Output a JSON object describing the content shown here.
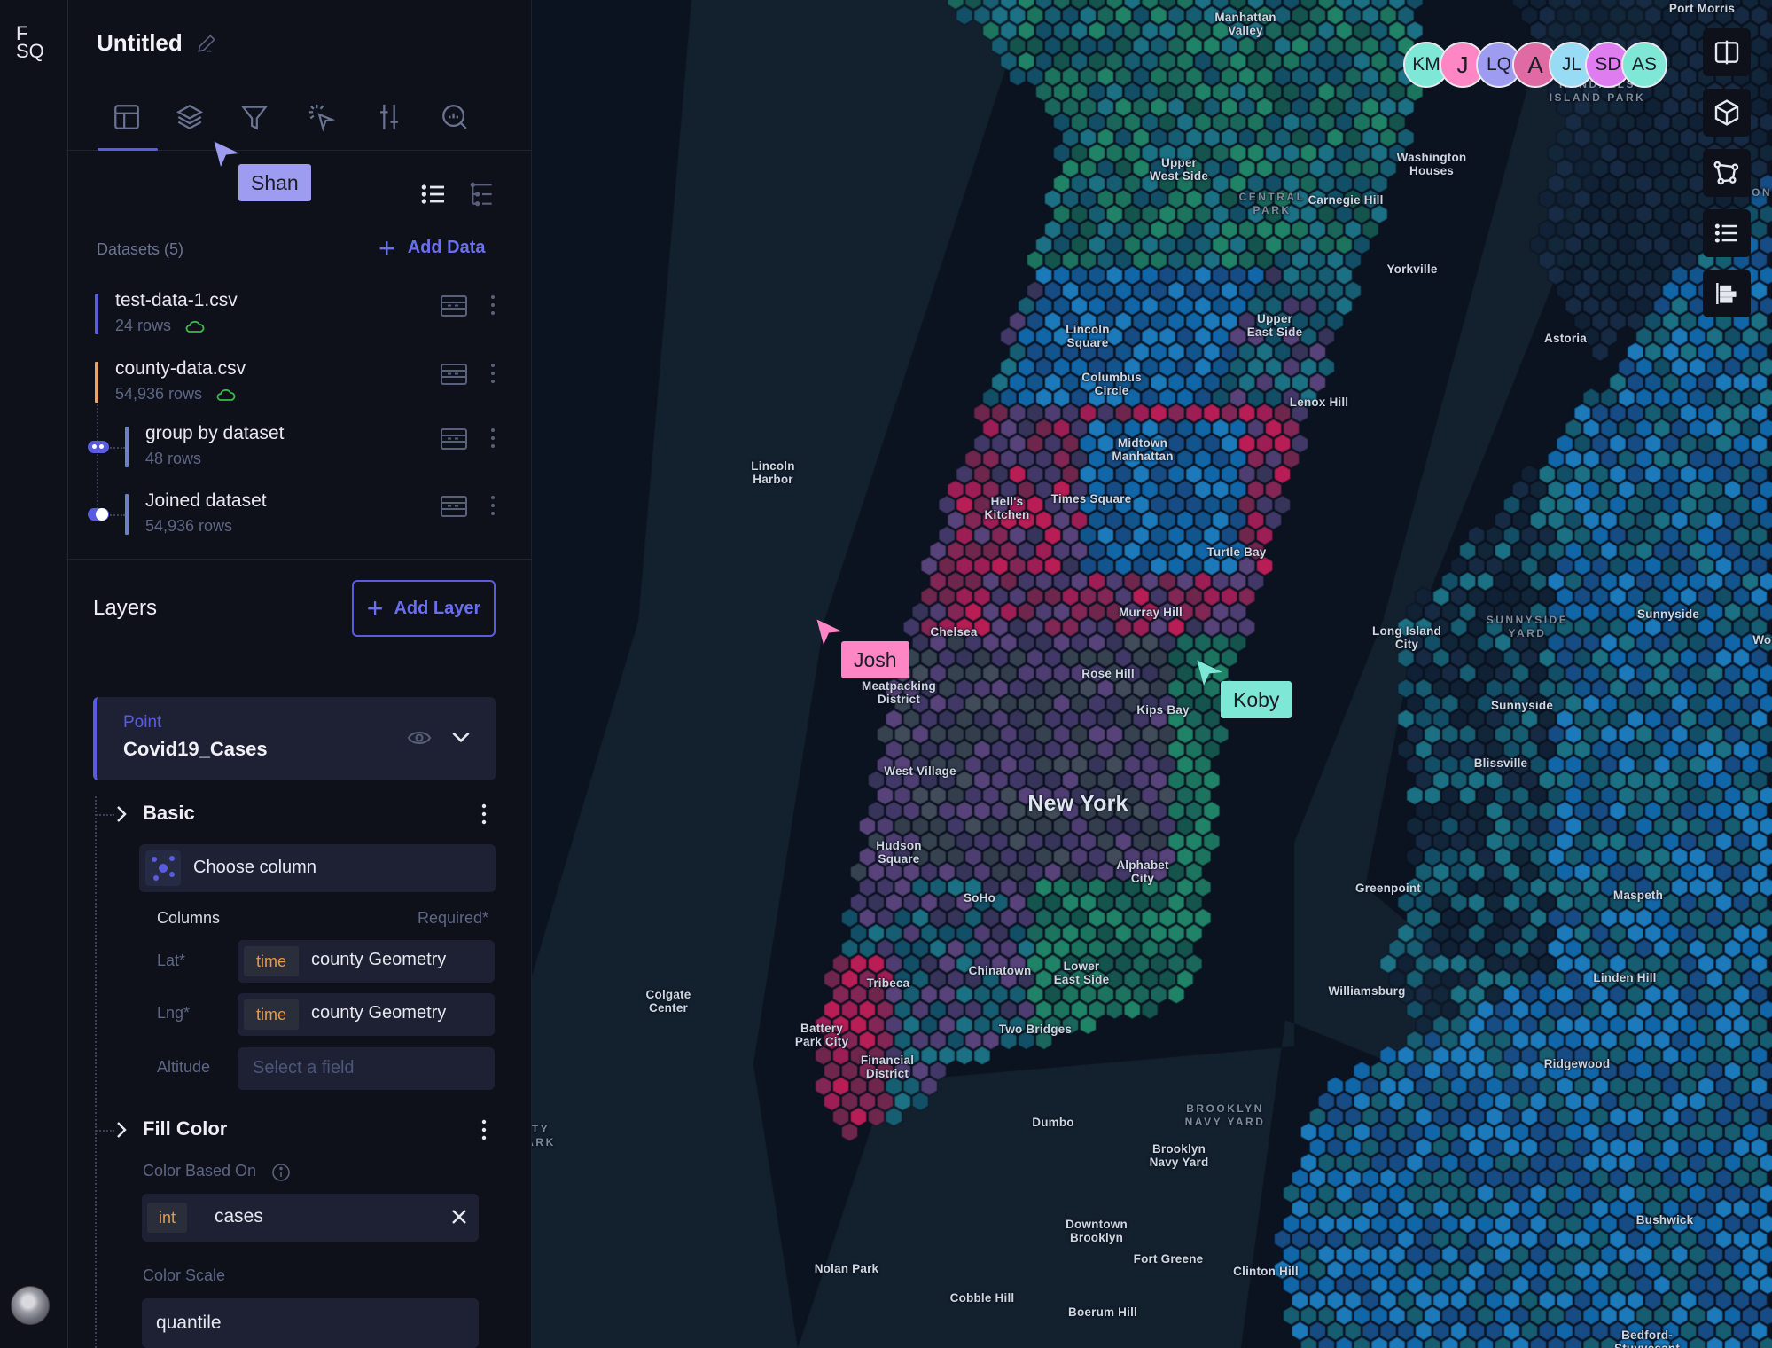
{
  "app": {
    "logo_line1": "F",
    "logo_line2": "SQ",
    "title": "Untitled"
  },
  "tabs": [
    {
      "name": "layout",
      "icon": "layout-icon",
      "active": true
    },
    {
      "name": "layers",
      "icon": "layers-icon",
      "active": false
    },
    {
      "name": "filters",
      "icon": "filter-icon",
      "active": false
    },
    {
      "name": "interactions",
      "icon": "interaction-cursor-icon",
      "active": false
    },
    {
      "name": "base-map",
      "icon": "sliders-icon",
      "active": false
    },
    {
      "name": "analysis",
      "icon": "search-chart-icon",
      "active": false
    }
  ],
  "datasets": {
    "header": "Datasets (5)",
    "add_label": "Add Data",
    "items": [
      {
        "name": "test-data-1.csv",
        "rows": "24 rows",
        "color": "#5a5ce0",
        "cloud": true
      },
      {
        "name": "county-data.csv",
        "rows": "54,936 rows",
        "color": "#f0a35e",
        "cloud": true
      },
      {
        "name": "group by dataset",
        "rows": "48 rows",
        "color": "#6c80c9",
        "cloud": false
      },
      {
        "name": "Joined dataset",
        "rows": "54,936 rows",
        "color": "#6c80c9",
        "cloud": false
      }
    ]
  },
  "layers": {
    "title": "Layers",
    "add_label": "Add Layer",
    "card": {
      "type": "Point",
      "name": "Covid19_Cases"
    },
    "basic": {
      "label": "Basic",
      "choose_column": "Choose column",
      "columns_label": "Columns",
      "required_label": "Required*",
      "fields": [
        {
          "label": "Lat*",
          "type": "time",
          "value": "county Geometry"
        },
        {
          "label": "Lng*",
          "type": "time",
          "value": "county Geometry"
        },
        {
          "label": "Altitude",
          "placeholder": "Select a field"
        }
      ]
    },
    "fill_color": {
      "label": "Fill Color",
      "based_on_label": "Color Based On",
      "based_on_type": "int",
      "based_on_value": "cases",
      "scale_label": "Color Scale",
      "scale_value": "quantile"
    }
  },
  "collaborators": {
    "cursors": [
      {
        "name": "Shan",
        "color": "#9d9cf0"
      },
      {
        "name": "Josh",
        "color": "#ff86c4"
      },
      {
        "name": "Koby",
        "color": "#7fe7d6"
      }
    ],
    "avatars": [
      {
        "initials": "KM",
        "color": "#7fe7d6"
      },
      {
        "initials": "J",
        "color": "#ff86c4"
      },
      {
        "initials": "LQ",
        "color": "#9d9cf0"
      },
      {
        "initials": "A",
        "color": "#e06aa4"
      },
      {
        "initials": "JL",
        "color": "#97dbf4"
      },
      {
        "initials": "SD",
        "color": "#df7cf0"
      },
      {
        "initials": "AS",
        "color": "#7fe7d6"
      }
    ]
  },
  "map_tools": [
    {
      "name": "split-map",
      "icon": "split-map-icon"
    },
    {
      "name": "3d-view",
      "icon": "cube-icon"
    },
    {
      "name": "draw-polygon",
      "icon": "polygon-icon"
    },
    {
      "name": "legend",
      "icon": "list-icon"
    },
    {
      "name": "layer-order",
      "icon": "bar-chart-icon"
    }
  ],
  "map_labels": [
    {
      "text": "Port Morris",
      "k": "n"
    },
    {
      "text": "Manhattan\nValley",
      "k": "n"
    },
    {
      "text": "RANDALLS\nISLAND PARK",
      "k": "park"
    },
    {
      "text": "Washington\nHouses",
      "k": "n"
    },
    {
      "text": "Upper\nWest Side",
      "k": "n"
    },
    {
      "text": "CENTRAL\nPARK",
      "k": "park"
    },
    {
      "text": "Carnegie Hill",
      "k": "n"
    },
    {
      "text": "Yorkville",
      "k": "n"
    },
    {
      "text": "Lincoln\nSquare",
      "k": "n"
    },
    {
      "text": "Upper\nEast Side",
      "k": "n"
    },
    {
      "text": "Astoria",
      "k": "n"
    },
    {
      "text": "Columbus\nCircle",
      "k": "n"
    },
    {
      "text": "Lenox Hill",
      "k": "n"
    },
    {
      "text": "Midtown\nManhattan",
      "k": "n"
    },
    {
      "text": "Lincoln\nHarbor",
      "k": "n"
    },
    {
      "text": "Hell's\nKitchen",
      "k": "n"
    },
    {
      "text": "Times Square",
      "k": "n"
    },
    {
      "text": "Turtle Bay",
      "k": "n"
    },
    {
      "text": "Murray Hill",
      "k": "n"
    },
    {
      "text": "Chelsea",
      "k": "n"
    },
    {
      "text": "SUNNYSIDE\nYARD",
      "k": "park"
    },
    {
      "text": "Sunnyside",
      "k": "n"
    },
    {
      "text": "Long Island\nCity",
      "k": "n"
    },
    {
      "text": "Rose Hill",
      "k": "n"
    },
    {
      "text": "Meatpacking\nDistrict",
      "k": "n"
    },
    {
      "text": "Kips Bay",
      "k": "n"
    },
    {
      "text": "Sunnyside",
      "k": "n"
    },
    {
      "text": "West Village",
      "k": "n"
    },
    {
      "text": "Blissville",
      "k": "n"
    },
    {
      "text": "New York",
      "k": "big"
    },
    {
      "text": "Hudson\nSquare",
      "k": "n"
    },
    {
      "text": "Alphabet\nCity",
      "k": "n"
    },
    {
      "text": "Greenpoint",
      "k": "n"
    },
    {
      "text": "Maspeth",
      "k": "n"
    },
    {
      "text": "SoHo",
      "k": "n"
    },
    {
      "text": "Chinatown",
      "k": "n"
    },
    {
      "text": "Lower\nEast Side",
      "k": "n"
    },
    {
      "text": "Tribeca",
      "k": "n"
    },
    {
      "text": "Linden Hill",
      "k": "n"
    },
    {
      "text": "Williamsburg",
      "k": "n"
    },
    {
      "text": "Colgate\nCenter",
      "k": "n"
    },
    {
      "text": "Battery\nPark City",
      "k": "n"
    },
    {
      "text": "Two Bridges",
      "k": "n"
    },
    {
      "text": "Financial\nDistrict",
      "k": "n"
    },
    {
      "text": "Ridgewood",
      "k": "n"
    },
    {
      "text": "Dumbo",
      "k": "n"
    },
    {
      "text": "BROOKLYN\nNAVY YARD",
      "k": "park"
    },
    {
      "text": "Brooklyn\nNavy Yard",
      "k": "n"
    },
    {
      "text": "Downtown\nBrooklyn",
      "k": "n"
    },
    {
      "text": "Bushwick",
      "k": "n"
    },
    {
      "text": "Fort Greene",
      "k": "n"
    },
    {
      "text": "Nolan Park",
      "k": "n"
    },
    {
      "text": "Clinton Hill",
      "k": "n"
    },
    {
      "text": "Cobble Hill",
      "k": "n"
    },
    {
      "text": "Boerum Hill",
      "k": "n"
    },
    {
      "text": "Bedford-\nStuyvesant",
      "k": "n"
    },
    {
      "text": "CON",
      "k": "park"
    },
    {
      "text": "Woo",
      "k": "n"
    },
    {
      "text": "TY\nARK",
      "k": "park"
    }
  ]
}
